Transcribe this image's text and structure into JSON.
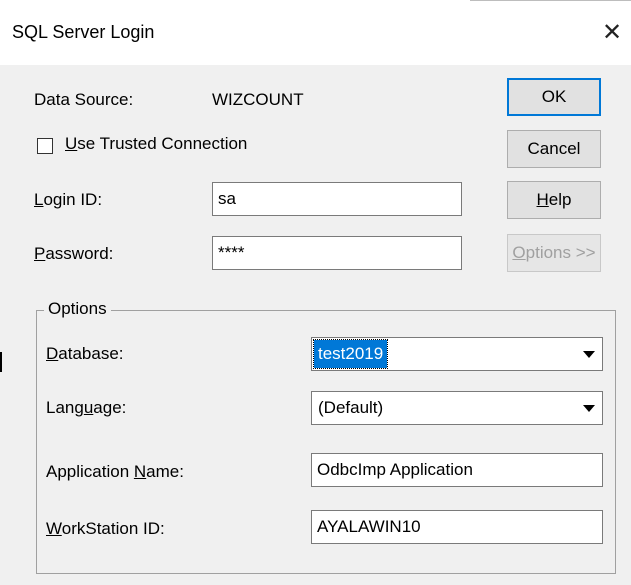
{
  "window": {
    "title": "SQL Server Login",
    "close_glyph": "✕"
  },
  "data_source": {
    "label": "Data Source:",
    "value": "WIZCOUNT"
  },
  "trusted": {
    "label_u": "U",
    "label_rest": "se Trusted Connection",
    "checked": false
  },
  "login": {
    "label_u": "L",
    "label_rest": "ogin ID:",
    "value": "sa"
  },
  "password": {
    "label_u": "P",
    "label_rest": "assword:",
    "value": "****"
  },
  "buttons": {
    "ok": "OK",
    "cancel": "Cancel",
    "help_u": "H",
    "help_rest": "elp",
    "options_u": "O",
    "options_rest": "ptions >>"
  },
  "options_group": {
    "title": "Options",
    "database": {
      "label_u": "D",
      "label_rest": "atabase:",
      "value": "test2019"
    },
    "language": {
      "label_pre": "Lang",
      "label_u": "u",
      "label_rest": "age:",
      "value": "(Default)"
    },
    "app_name": {
      "label_pre": "Application ",
      "label_u": "N",
      "label_rest": "ame:",
      "value": "OdbcImp Application"
    },
    "workstation": {
      "label_u": "W",
      "label_rest": "orkStation ID:",
      "value": "AYALAWIN10"
    }
  },
  "colors": {
    "accent": "#0078d7",
    "face": "#f0f0f0"
  },
  "icons": {
    "close": "close-icon",
    "dropdown": "chevron-down-icon"
  }
}
